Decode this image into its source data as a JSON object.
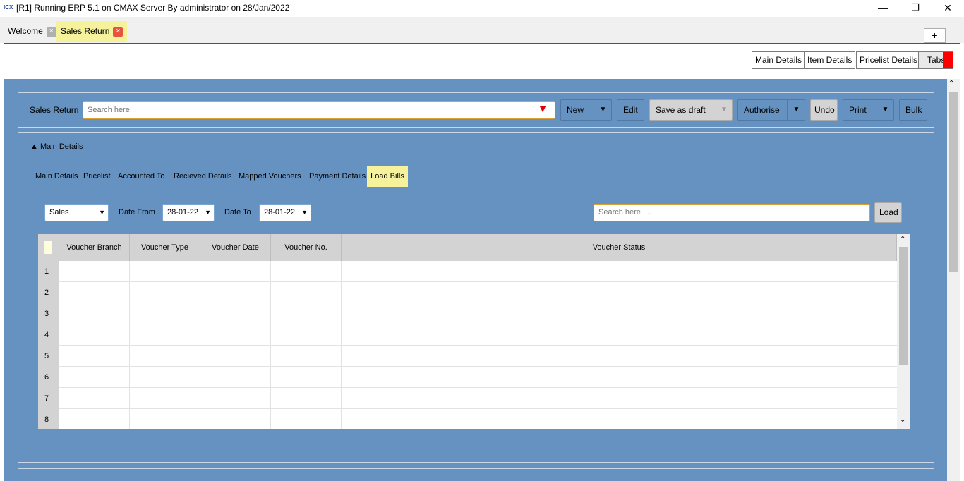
{
  "window": {
    "title": "[R1] Running ERP 5.1 on CMAX Server By administrator on 28/Jan/2022",
    "app_icon": "ICX",
    "minimize": "—",
    "restore": "❐",
    "close": "✕"
  },
  "doc_tabs": [
    {
      "label": "Welcome",
      "active": false
    },
    {
      "label": "Sales Return",
      "active": true
    }
  ],
  "add_tab_label": "+",
  "section_buttons": [
    "Main Details",
    "Item Details",
    "Pricelist Details",
    "Tabs"
  ],
  "toolbar": {
    "label": "Sales Return",
    "search_placeholder": "Search here...",
    "new": "New",
    "edit": "Edit",
    "save_draft": "Save as draft",
    "authorise": "Authorise",
    "undo": "Undo",
    "print": "Print",
    "bulk": "Bulk"
  },
  "panel": {
    "title": "▲ Main Details",
    "tabs": [
      "Main Details",
      "Pricelist",
      "Accounted To",
      "Recieved Details",
      "Mapped Vouchers",
      "Payment Details",
      "Load Bills"
    ],
    "active_tab": "Load Bills"
  },
  "filters": {
    "type_value": "Sales",
    "date_from_label": "Date From",
    "date_from": "28-01-22",
    "date_to_label": "Date To",
    "date_to": "28-01-22",
    "search_placeholder": "Search here ....",
    "load": "Load"
  },
  "grid": {
    "columns": [
      "Voucher Branch",
      "Voucher Type",
      "Voucher Date",
      "Voucher No.",
      "Voucher Status"
    ],
    "rows": [
      "1",
      "2",
      "3",
      "4",
      "5",
      "6",
      "7",
      "8"
    ]
  },
  "colors": {
    "panel_blue": "#6592c1",
    "active_tab_yellow": "#f5f29b",
    "close_red": "#e8533f",
    "divider_green": "#2e6b2e"
  },
  "icons": {
    "dropdown": "▼",
    "scroll_up": "⌃",
    "scroll_down": "⌄"
  }
}
